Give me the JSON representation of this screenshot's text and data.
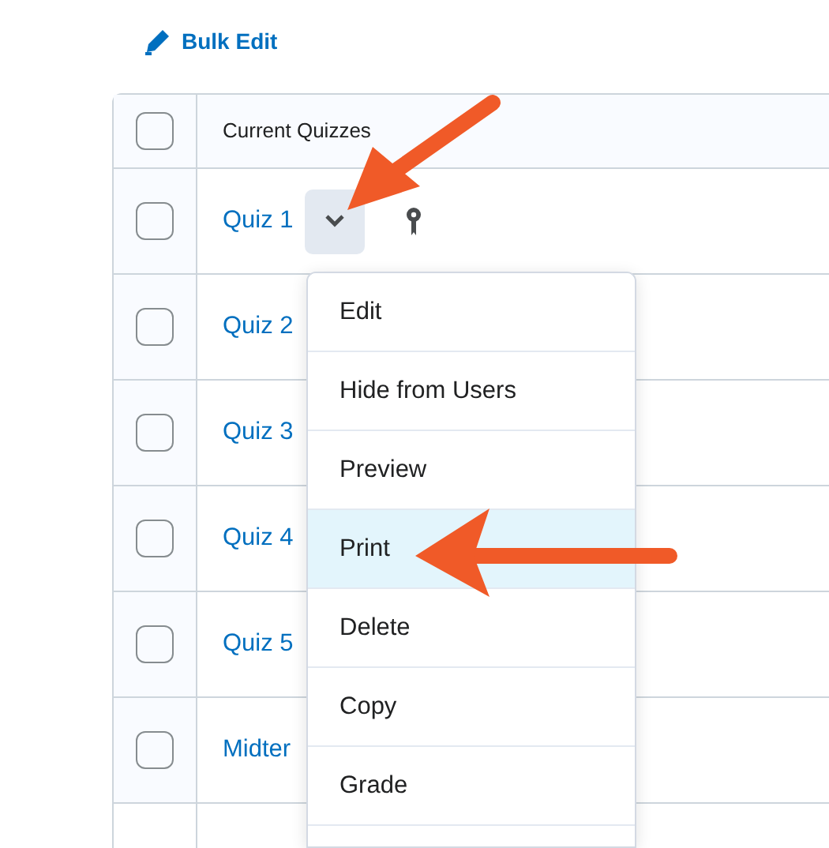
{
  "toolbar": {
    "bulk_edit": "Bulk Edit"
  },
  "table": {
    "columns": [
      "Current Quizzes"
    ],
    "header_checked": false,
    "rows": [
      {
        "title": "Quiz 1",
        "checked": false,
        "kind": "actions"
      },
      {
        "title": "Quiz 2",
        "checked": false,
        "kind": "plain"
      },
      {
        "title": "Quiz 3",
        "checked": false,
        "kind": "plain"
      },
      {
        "title": "Quiz 4",
        "checked": false,
        "kind": "plain"
      },
      {
        "title": "Quiz 5",
        "checked": false,
        "kind": "plain"
      },
      {
        "title": "Midter",
        "checked": false,
        "kind": "plain"
      }
    ]
  },
  "menu": {
    "items": [
      {
        "label": "Edit",
        "selected": false
      },
      {
        "label": "Hide from Users",
        "selected": false
      },
      {
        "label": "Preview",
        "selected": false
      },
      {
        "label": "Print",
        "selected": true
      },
      {
        "label": "Delete",
        "selected": false
      },
      {
        "label": "Copy",
        "selected": false
      },
      {
        "label": "Grade",
        "selected": false
      }
    ]
  }
}
